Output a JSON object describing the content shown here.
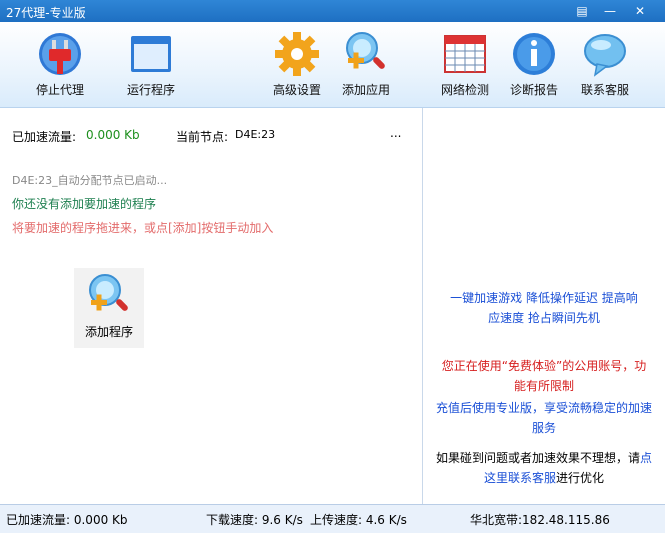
{
  "window": {
    "title": "27代理-专业版"
  },
  "toolbar": {
    "stop_proxy": "停止代理",
    "run_program": "运行程序",
    "advanced_settings": "高级设置",
    "add_app": "添加应用",
    "network_check": "网络检测",
    "diagnose_report": "诊断报告",
    "contact_support": "联系客服"
  },
  "left": {
    "accel_traffic_label": "已加速流量:",
    "accel_traffic_value": "0.000 Kb",
    "current_node_label": "当前节点:",
    "current_node_value": "D4E:23",
    "more": "...",
    "log_line": "D4E:23_自动分配节点已启动...",
    "hint_no_program": "你还没有添加要加速的程序",
    "hint_drag": "将要加速的程序拖进来，或点[添加]按钮手动加入",
    "add_program_label": "添加程序"
  },
  "right": {
    "promo_line1": "一键加速游戏 降低操作延迟 提高响",
    "promo_line2": "应速度 抢占瞬间先机",
    "warn_line1": "您正在使用“免费体验”的公用账号，功",
    "warn_line2": "能有所限制",
    "upgrade_line1": "充值后使用专业版，享受流畅稳定的加速",
    "upgrade_line2": "服务",
    "help_prefix": "如果碰到问题或者加速效果不理想，请",
    "help_link_part1": "点",
    "help_link_part2": "这里联系客服",
    "help_suffix": "进行优化"
  },
  "status": {
    "accel_traffic": "已加速流量: 0.000 Kb",
    "download_speed": "下载速度: 9.6 K/s",
    "upload_speed": "上传速度: 4.6 K/s",
    "ip": "华北宽带:182.48.115.86"
  },
  "colors": {
    "link": "#1a4fd6",
    "green": "#1d8f1d",
    "red": "#e33b3b"
  }
}
